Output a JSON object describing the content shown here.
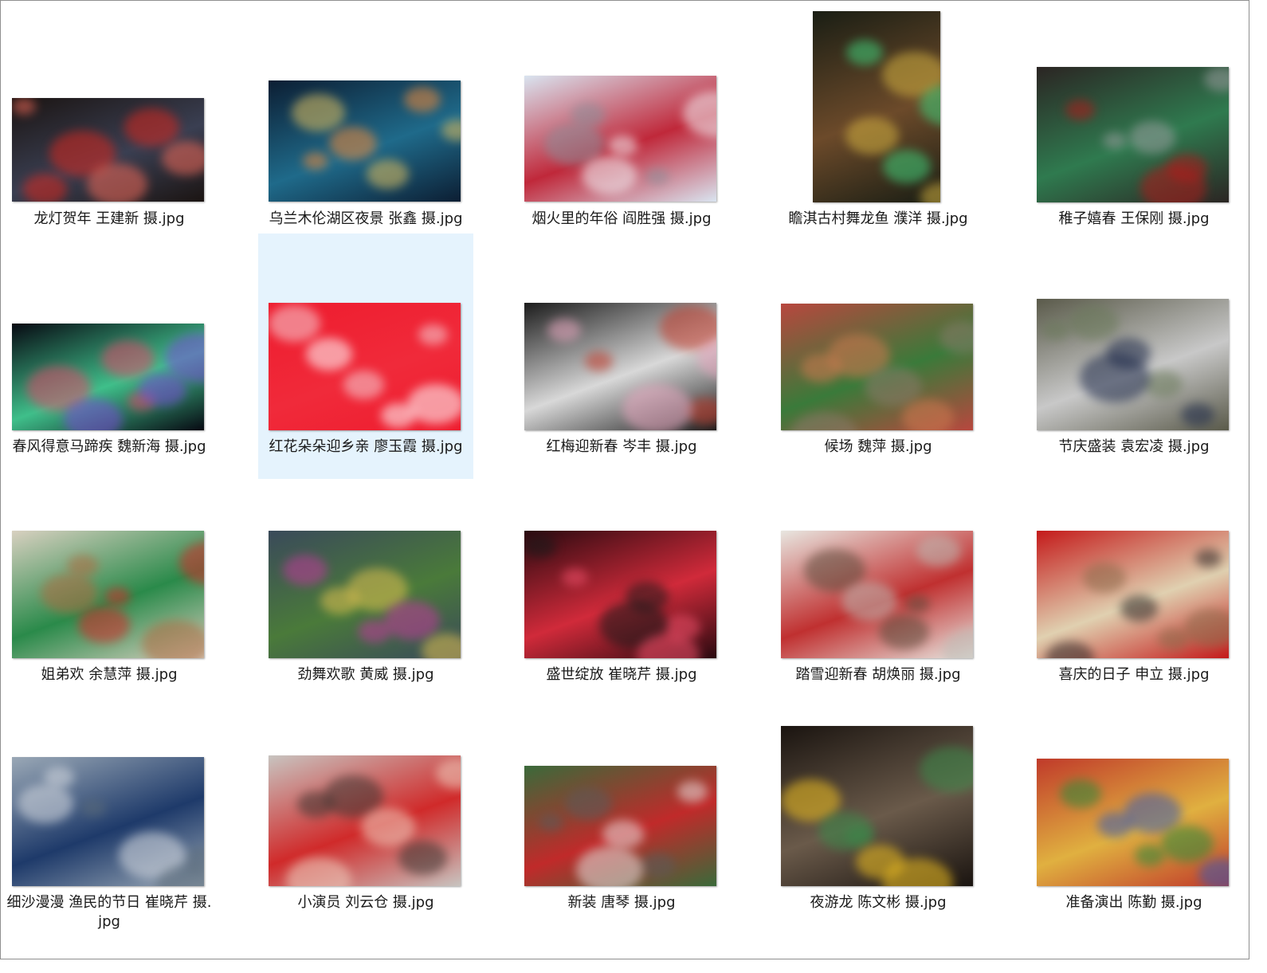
{
  "files": [
    {
      "name": "龙灯贺年  王建新 摄.jpg",
      "colors": [
        "#1b1412",
        "#d6271e",
        "#3a3f52",
        "#f06a5a"
      ]
    },
    {
      "name": "乌兰木伦湖区夜景  张鑫 摄.jpg",
      "colors": [
        "#0c1e33",
        "#f08a3a",
        "#1f6a8a",
        "#e0c060"
      ]
    },
    {
      "name": "烟火里的年俗  阎胜强 摄.jpg",
      "colors": [
        "#d9e4f0",
        "#f2f4f8",
        "#c0283a",
        "#8a8f9a"
      ]
    },
    {
      "name": "瞻淇古村舞龙鱼  濮洋 摄.jpg",
      "colors": [
        "#1a1e14",
        "#3fcf7a",
        "#6c4a2a",
        "#d2b040"
      ]
    },
    {
      "name": "稚子嬉春  王保刚 摄.jpg",
      "colors": [
        "#2b2523",
        "#b01a1a",
        "#2f7a4f",
        "#9a9c9e"
      ]
    },
    {
      "name": "春风得意马蹄疾  魏新海 摄.jpg",
      "colors": [
        "#070912",
        "#7a4cd8",
        "#3fbf8a",
        "#e04a6a"
      ]
    },
    {
      "name": "红花朵朵迎乡亲  廖玉霞 摄.jpg",
      "colors": [
        "#ee1c2e",
        "#f5d0d5",
        "#f02a3a",
        "#ffffff"
      ]
    },
    {
      "name": "红梅迎新春  岑丰 摄.jpg",
      "colors": [
        "#1c1c1c",
        "#e9a8c0",
        "#d8d8d8",
        "#c23a2a"
      ]
    },
    {
      "name": "候场  魏萍 摄.jpg",
      "colors": [
        "#b8473e",
        "#d07a50",
        "#3a7a3a",
        "#8a7a6a"
      ]
    },
    {
      "name": "节庆盛装  袁宏凌 摄.jpg",
      "colors": [
        "#5a5a4a",
        "#1e2a4a",
        "#c8c8c8",
        "#6a7a5a"
      ]
    },
    {
      "name": "姐弟欢  余慧萍 摄.jpg",
      "colors": [
        "#d8d0c0",
        "#d72a2a",
        "#2a8a4a",
        "#b06a40"
      ]
    },
    {
      "name": "劲舞欢歌  黄威 摄.jpg",
      "colors": [
        "#3a4a5a",
        "#c03a9a",
        "#4a7a3a",
        "#e0c050"
      ]
    },
    {
      "name": "盛世绽放  崔晓芹 摄.jpg",
      "colors": [
        "#2a0a10",
        "#f0506a",
        "#d02a3a",
        "#1a1a1a"
      ]
    },
    {
      "name": "踏雪迎新春  胡焕丽 摄.jpg",
      "colors": [
        "#e8e6e0",
        "#bcbab4",
        "#c03030",
        "#5a4a3a"
      ]
    },
    {
      "name": "喜庆的日子  申立 摄.jpg",
      "colors": [
        "#c41a1a",
        "#2a2424",
        "#e0d0b0",
        "#8a6a4a"
      ]
    },
    {
      "name": "细沙漫漫   渔民的节日  崔晓芹 摄.jpg",
      "colors": [
        "#9aa8b6",
        "#d8dce2",
        "#1e3a6a",
        "#5a6a78"
      ]
    },
    {
      "name": "小演员  刘云仓 摄.jpg",
      "colors": [
        "#c8c4c0",
        "#3a3430",
        "#d02a2a",
        "#f0d0c0"
      ]
    },
    {
      "name": "新装  唐琴 摄.jpg",
      "colors": [
        "#3a6a3a",
        "#e8e0e0",
        "#c02a2a",
        "#5a5a5a"
      ]
    },
    {
      "name": "夜游龙  陈文彬 摄.jpg",
      "colors": [
        "#1a1410",
        "#f0c020",
        "#6a5a4a",
        "#3a8a4a"
      ]
    },
    {
      "name": "准备演出  陈勤 摄.jpg",
      "colors": [
        "#c03a2a",
        "#2a8a3a",
        "#e0b040",
        "#3a5ab0"
      ]
    }
  ]
}
